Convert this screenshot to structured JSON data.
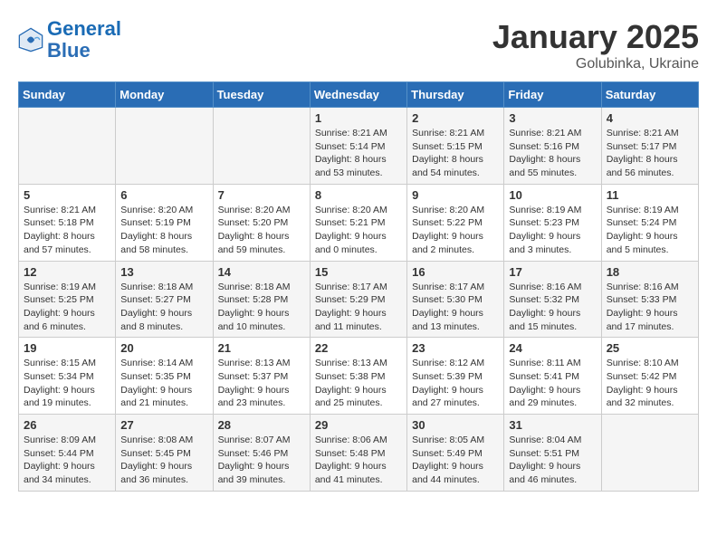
{
  "header": {
    "logo_line1": "General",
    "logo_line2": "Blue",
    "title": "January 2025",
    "subtitle": "Golubinka, Ukraine"
  },
  "weekdays": [
    "Sunday",
    "Monday",
    "Tuesday",
    "Wednesday",
    "Thursday",
    "Friday",
    "Saturday"
  ],
  "weeks": [
    [
      {
        "day": "",
        "info": ""
      },
      {
        "day": "",
        "info": ""
      },
      {
        "day": "",
        "info": ""
      },
      {
        "day": "1",
        "info": "Sunrise: 8:21 AM\nSunset: 5:14 PM\nDaylight: 8 hours and 53 minutes."
      },
      {
        "day": "2",
        "info": "Sunrise: 8:21 AM\nSunset: 5:15 PM\nDaylight: 8 hours and 54 minutes."
      },
      {
        "day": "3",
        "info": "Sunrise: 8:21 AM\nSunset: 5:16 PM\nDaylight: 8 hours and 55 minutes."
      },
      {
        "day": "4",
        "info": "Sunrise: 8:21 AM\nSunset: 5:17 PM\nDaylight: 8 hours and 56 minutes."
      }
    ],
    [
      {
        "day": "5",
        "info": "Sunrise: 8:21 AM\nSunset: 5:18 PM\nDaylight: 8 hours and 57 minutes."
      },
      {
        "day": "6",
        "info": "Sunrise: 8:20 AM\nSunset: 5:19 PM\nDaylight: 8 hours and 58 minutes."
      },
      {
        "day": "7",
        "info": "Sunrise: 8:20 AM\nSunset: 5:20 PM\nDaylight: 8 hours and 59 minutes."
      },
      {
        "day": "8",
        "info": "Sunrise: 8:20 AM\nSunset: 5:21 PM\nDaylight: 9 hours and 0 minutes."
      },
      {
        "day": "9",
        "info": "Sunrise: 8:20 AM\nSunset: 5:22 PM\nDaylight: 9 hours and 2 minutes."
      },
      {
        "day": "10",
        "info": "Sunrise: 8:19 AM\nSunset: 5:23 PM\nDaylight: 9 hours and 3 minutes."
      },
      {
        "day": "11",
        "info": "Sunrise: 8:19 AM\nSunset: 5:24 PM\nDaylight: 9 hours and 5 minutes."
      }
    ],
    [
      {
        "day": "12",
        "info": "Sunrise: 8:19 AM\nSunset: 5:25 PM\nDaylight: 9 hours and 6 minutes."
      },
      {
        "day": "13",
        "info": "Sunrise: 8:18 AM\nSunset: 5:27 PM\nDaylight: 9 hours and 8 minutes."
      },
      {
        "day": "14",
        "info": "Sunrise: 8:18 AM\nSunset: 5:28 PM\nDaylight: 9 hours and 10 minutes."
      },
      {
        "day": "15",
        "info": "Sunrise: 8:17 AM\nSunset: 5:29 PM\nDaylight: 9 hours and 11 minutes."
      },
      {
        "day": "16",
        "info": "Sunrise: 8:17 AM\nSunset: 5:30 PM\nDaylight: 9 hours and 13 minutes."
      },
      {
        "day": "17",
        "info": "Sunrise: 8:16 AM\nSunset: 5:32 PM\nDaylight: 9 hours and 15 minutes."
      },
      {
        "day": "18",
        "info": "Sunrise: 8:16 AM\nSunset: 5:33 PM\nDaylight: 9 hours and 17 minutes."
      }
    ],
    [
      {
        "day": "19",
        "info": "Sunrise: 8:15 AM\nSunset: 5:34 PM\nDaylight: 9 hours and 19 minutes."
      },
      {
        "day": "20",
        "info": "Sunrise: 8:14 AM\nSunset: 5:35 PM\nDaylight: 9 hours and 21 minutes."
      },
      {
        "day": "21",
        "info": "Sunrise: 8:13 AM\nSunset: 5:37 PM\nDaylight: 9 hours and 23 minutes."
      },
      {
        "day": "22",
        "info": "Sunrise: 8:13 AM\nSunset: 5:38 PM\nDaylight: 9 hours and 25 minutes."
      },
      {
        "day": "23",
        "info": "Sunrise: 8:12 AM\nSunset: 5:39 PM\nDaylight: 9 hours and 27 minutes."
      },
      {
        "day": "24",
        "info": "Sunrise: 8:11 AM\nSunset: 5:41 PM\nDaylight: 9 hours and 29 minutes."
      },
      {
        "day": "25",
        "info": "Sunrise: 8:10 AM\nSunset: 5:42 PM\nDaylight: 9 hours and 32 minutes."
      }
    ],
    [
      {
        "day": "26",
        "info": "Sunrise: 8:09 AM\nSunset: 5:44 PM\nDaylight: 9 hours and 34 minutes."
      },
      {
        "day": "27",
        "info": "Sunrise: 8:08 AM\nSunset: 5:45 PM\nDaylight: 9 hours and 36 minutes."
      },
      {
        "day": "28",
        "info": "Sunrise: 8:07 AM\nSunset: 5:46 PM\nDaylight: 9 hours and 39 minutes."
      },
      {
        "day": "29",
        "info": "Sunrise: 8:06 AM\nSunset: 5:48 PM\nDaylight: 9 hours and 41 minutes."
      },
      {
        "day": "30",
        "info": "Sunrise: 8:05 AM\nSunset: 5:49 PM\nDaylight: 9 hours and 44 minutes."
      },
      {
        "day": "31",
        "info": "Sunrise: 8:04 AM\nSunset: 5:51 PM\nDaylight: 9 hours and 46 minutes."
      },
      {
        "day": "",
        "info": ""
      }
    ]
  ]
}
